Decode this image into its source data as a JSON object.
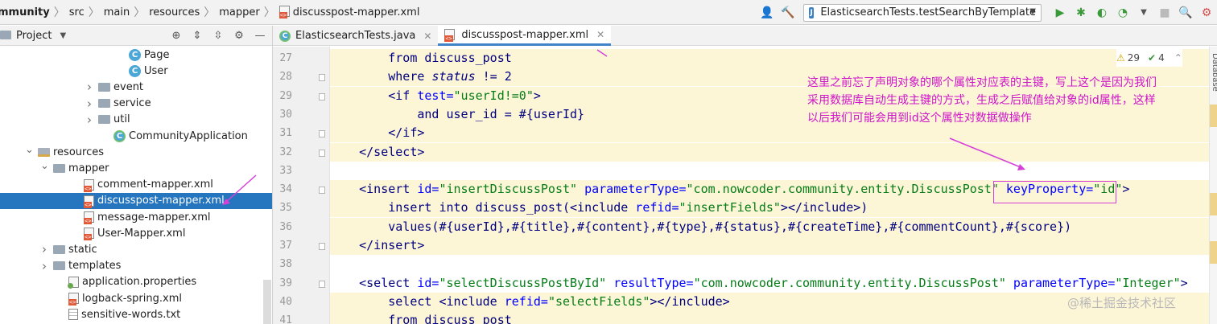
{
  "breadcrumb": [
    "mmunity",
    "src",
    "main",
    "resources",
    "mapper",
    "discusspost-mapper.xml"
  ],
  "run_config": {
    "label": "ElasticsearchTests.testSearchByTemplate"
  },
  "project_panel": {
    "title": "Project"
  },
  "tree": [
    {
      "label": "Page",
      "icon": "class-icon",
      "indent": 160,
      "arrow": ""
    },
    {
      "label": "User",
      "icon": "class-icon",
      "indent": 160,
      "arrow": ""
    },
    {
      "label": "event",
      "icon": "folder-icon",
      "indent": 122,
      "arrow": ">"
    },
    {
      "label": "service",
      "icon": "folder-icon",
      "indent": 122,
      "arrow": ">"
    },
    {
      "label": "util",
      "icon": "folder-icon",
      "indent": 122,
      "arrow": ">"
    },
    {
      "label": "CommunityApplication",
      "icon": "spring-app-icon",
      "indent": 141,
      "arrow": ""
    },
    {
      "label": "resources",
      "icon": "resources-folder-icon",
      "indent": 47,
      "arrow": "v"
    },
    {
      "label": "mapper",
      "icon": "folder-icon",
      "indent": 66,
      "arrow": "v"
    },
    {
      "label": "comment-mapper.xml",
      "icon": "xml-file-icon",
      "indent": 104,
      "arrow": ""
    },
    {
      "label": "discusspost-mapper.xml",
      "icon": "xml-file-icon",
      "indent": 104,
      "arrow": "",
      "selected": true
    },
    {
      "label": "message-mapper.xml",
      "icon": "xml-file-icon",
      "indent": 104,
      "arrow": ""
    },
    {
      "label": "User-Mapper.xml",
      "icon": "xml-file-icon",
      "indent": 104,
      "arrow": ""
    },
    {
      "label": "static",
      "icon": "folder-icon",
      "indent": 66,
      "arrow": ">"
    },
    {
      "label": "templates",
      "icon": "folder-icon",
      "indent": 66,
      "arrow": ">"
    },
    {
      "label": "application.properties",
      "icon": "properties-file-icon",
      "indent": 85,
      "arrow": ""
    },
    {
      "label": "logback-spring.xml",
      "icon": "xml-file-icon",
      "indent": 85,
      "arrow": ""
    },
    {
      "label": "sensitive-words.txt",
      "icon": "text-file-icon",
      "indent": 85,
      "arrow": ""
    }
  ],
  "tabs": [
    {
      "label": "ElasticsearchTests.java",
      "active": false
    },
    {
      "label": "discusspost-mapper.xml",
      "active": true
    }
  ],
  "inspection": {
    "warnings": "29",
    "ok": "4"
  },
  "code": [
    {
      "n": "27",
      "hl": true,
      "html": "        <span class=\"tg\">from discuss_post</span>"
    },
    {
      "n": "28",
      "hl": true,
      "html": "        <span class=\"tg\">where</span> <span class=\"tg it\">status</span> <span class=\"tg\">!= 2</span>"
    },
    {
      "n": "29",
      "hl": true,
      "html": "        <span class=\"tg\">&lt;if</span> <span class=\"at\">test=</span><span class=\"av\">\"userId!=0\"</span><span class=\"tg\">&gt;</span>"
    },
    {
      "n": "30",
      "hl": true,
      "html": "            <span class=\"tg\">and user_id = #{userId}</span>"
    },
    {
      "n": "31",
      "hl": true,
      "html": "        <span class=\"tg\">&lt;/if&gt;</span>"
    },
    {
      "n": "32",
      "hl": true,
      "html": "    <span class=\"tg\">&lt;/select&gt;</span>"
    },
    {
      "n": "33",
      "hl": false,
      "html": ""
    },
    {
      "n": "34",
      "hl": true,
      "html": "    <span class=\"tg\">&lt;insert</span> <span class=\"at\">id=</span><span class=\"av\">\"insertDiscussPost\"</span> <span class=\"at\">parameterType=</span><span class=\"av\">\"com.nowcoder.community.entity.DiscussPost\"</span> <span class=\"at\">keyProperty=</span><span class=\"av\">\"id\"</span><span class=\"tg\">&gt;</span>"
    },
    {
      "n": "35",
      "hl": true,
      "html": "        <span class=\"tg\">insert into discuss_post(&lt;include</span> <span class=\"at\">refid=</span><span class=\"av\">\"insertFields\"</span><span class=\"tg\">&gt;&lt;/include&gt;)</span>"
    },
    {
      "n": "36",
      "hl": true,
      "html": "        <span class=\"tg\">values(#{userId},#{title},#{content},#{type},#{status},#{createTime},#{commentCount},#{score})</span>"
    },
    {
      "n": "37",
      "hl": true,
      "html": "    <span class=\"tg\">&lt;/insert&gt;</span>"
    },
    {
      "n": "38",
      "hl": false,
      "html": ""
    },
    {
      "n": "39",
      "hl": false,
      "html": "    <span class=\"tg\">&lt;select</span> <span class=\"at\">id=</span><span class=\"av\">\"selectDiscussPostById\"</span> <span class=\"at\">resultType=</span><span class=\"av\">\"com.nowcoder.community.entity.DiscussPost\"</span> <span class=\"at\">parameterType=</span><span class=\"av\">\"Integer\"</span><span class=\"tg\">&gt;</span>"
    },
    {
      "n": "40",
      "hl": true,
      "html": "        <span class=\"tg\">select &lt;include</span> <span class=\"at\">refid=</span><span class=\"av\">\"selectFields\"</span><span class=\"tg\">&gt;&lt;/include&gt;</span>"
    },
    {
      "n": "41",
      "hl": true,
      "html": "        <span class=\"tg\">from discuss_post</span>"
    }
  ],
  "annotation": "这里之前忘了声明对象的哪个属性对应表的主键，写上这个是因为我们采用数据库自动生成主键的方式，生成之后赋值给对象的id属性，这样以后我们可能会用到id这个属性对数据做操作",
  "side_tool": "Database",
  "watermark": "@稀土掘金技术社区",
  "colors": {
    "selection": "#2675bf",
    "highlight": "#fcf6d7",
    "annotation": "#d014c8",
    "tag": "#000080",
    "attr": "#0000ff",
    "value": "#067d17"
  }
}
